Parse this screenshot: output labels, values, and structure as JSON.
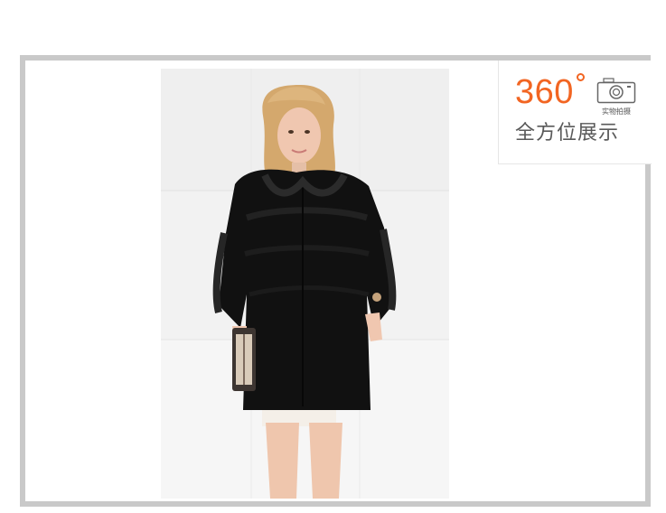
{
  "badge": {
    "number": "360",
    "caption": "全方位展示",
    "camera_caption": "实物拍摄",
    "accent_color": "#f26522",
    "text_color": "#595959"
  },
  "product_image": {
    "description_icon": "model-in-black-fur-coat-photo"
  },
  "frame": {
    "border_color": "#c9c9c9"
  }
}
